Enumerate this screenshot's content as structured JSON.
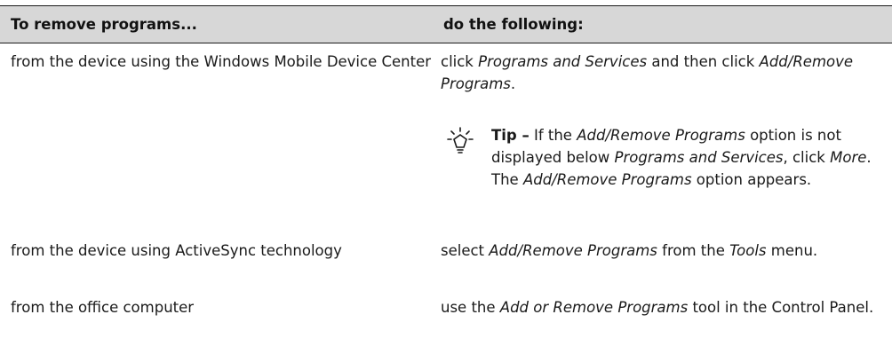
{
  "table": {
    "headers": [
      "To remove programs...",
      "do the following:"
    ],
    "rows": [
      {
        "left": "from the device using the Windows Mobile Device Center",
        "right": {
          "a": "click ",
          "b": "Programs and Services",
          "c": " and then click ",
          "d": "Add/Remove Programs",
          "e": "."
        },
        "tip": {
          "label": "Tip –",
          "t1": " If the ",
          "t2": "Add/Remove Programs",
          "t3": " option is not displayed below ",
          "t4": "Programs and Services",
          "t5": ", click ",
          "t6": "More",
          "t7": ". The ",
          "t8": "Add/Remove Programs",
          "t9": " option appears."
        }
      },
      {
        "left": "from the device using ActiveSync technology",
        "right": {
          "a": "select ",
          "b": "Add/Remove Programs",
          "c": " from the ",
          "d": "Tools",
          "e": " menu."
        }
      },
      {
        "left": "from the office computer",
        "right": {
          "a": "use the ",
          "b": "Add or Remove Programs",
          "c": " tool in the Control Panel."
        }
      }
    ]
  },
  "icons": {
    "tip": "lightbulb-icon"
  }
}
